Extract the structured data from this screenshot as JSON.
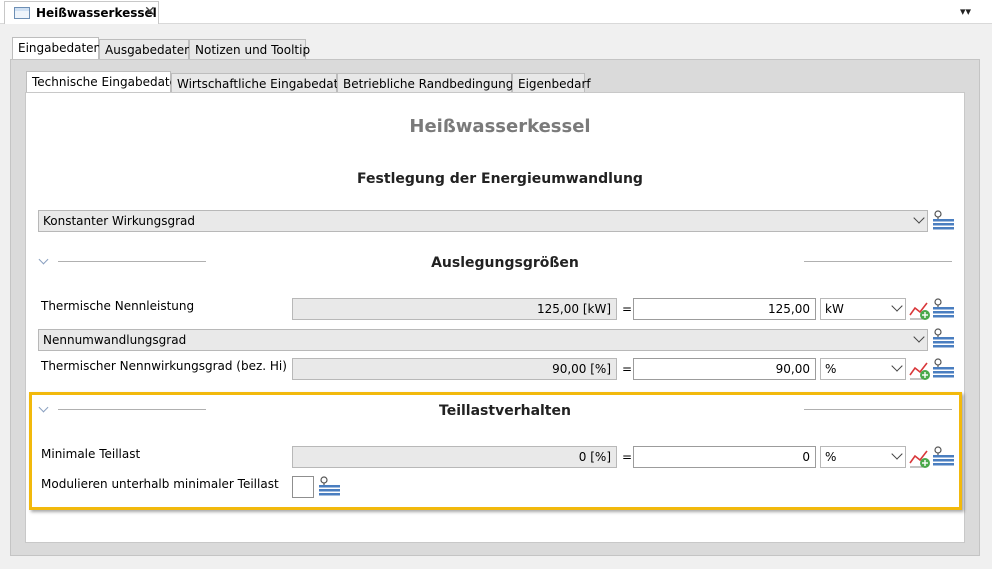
{
  "editor": {
    "tab_title": "Heißwasserkessel",
    "close_glyph": "✕",
    "menu_glyph": "▾▾"
  },
  "outer_tabs": [
    {
      "label": "Eingabedaten",
      "active": true
    },
    {
      "label": "Ausgabedaten",
      "active": false
    },
    {
      "label": "Notizen und Tooltip",
      "active": false
    }
  ],
  "inner_tabs": [
    {
      "label": "Technische Eingabedaten",
      "active": true
    },
    {
      "label": "Wirtschaftliche Eingabedaten",
      "active": false
    },
    {
      "label": "Betriebliche Randbedingungen",
      "active": false
    },
    {
      "label": "Eigenbedarf",
      "active": false
    }
  ],
  "form": {
    "title": "Heißwasserkessel",
    "energy_section": {
      "heading": "Festlegung der Energieumwandlung",
      "mode_select": "Konstanter Wirkungsgrad"
    },
    "design_section": {
      "heading": "Auslegungsgrößen",
      "rows": [
        {
          "label": "Thermische Nennleistung",
          "computed": "125,00 [kW]",
          "equals": "=",
          "value": "125,00",
          "unit": "kW"
        },
        {
          "label": "Thermischer Nennwirkungsgrad (bez. Hi)",
          "computed": "90,00 [%]",
          "equals": "=",
          "value": "90,00",
          "unit": "%"
        }
      ],
      "conversion_select": "Nennumwandlungsgrad"
    },
    "partload_section": {
      "heading": "Teillastverhalten",
      "min_partload": {
        "label": "Minimale Teillast",
        "computed": "0 [%]",
        "equals": "=",
        "value": "0",
        "unit": "%"
      },
      "modulate_label": "Modulieren unterhalb minimaler Teillast"
    }
  },
  "icons": {
    "chart": "chart-add-icon",
    "list": "pin-list-icon",
    "collapse": "chevron-down-icon"
  },
  "colors": {
    "highlight": "#f2b90c",
    "title_gray": "#7a7a7a",
    "chart_red": "#d9373a",
    "chart_green": "#4aa84a",
    "list_blue": "#4a7ec0"
  }
}
